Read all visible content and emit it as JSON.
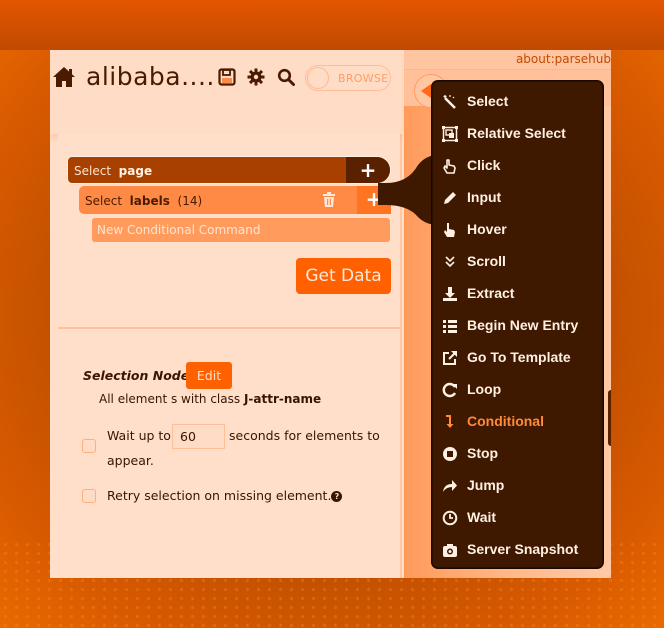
{
  "header": {
    "project_title": "alibaba....",
    "browse_toggle_label": "BROWSE"
  },
  "commands": {
    "select_page": {
      "verb": "Select",
      "target": "page"
    },
    "select_labels": {
      "verb": "Select",
      "target": "labels",
      "count": "(14)"
    },
    "conditional": "New Conditional Command",
    "get_data_label": "Get Data"
  },
  "selection_panel": {
    "node_label": "Selection Node:",
    "edit_label": "Edit",
    "description_prefix": "All element s with class",
    "description_class": "J-attr-name",
    "wait_prefix": "Wait up to",
    "wait_value": "60",
    "wait_suffix": "seconds for elements to",
    "wait_suffix2": "appear.",
    "retry_label": "Retry selection on missing element.",
    "help_glyph": "?"
  },
  "browser": {
    "url": "about:parsehub"
  },
  "menu": {
    "items": [
      {
        "label": "Select",
        "icon": "magic-wand-icon"
      },
      {
        "label": "Relative Select",
        "icon": "relative-select-icon"
      },
      {
        "label": "Click",
        "icon": "pointer-hand-icon"
      },
      {
        "label": "Input",
        "icon": "pencil-icon"
      },
      {
        "label": "Hover",
        "icon": "hover-hand-icon"
      },
      {
        "label": "Scroll",
        "icon": "double-chevron-down-icon"
      },
      {
        "label": "Extract",
        "icon": "download-icon"
      },
      {
        "label": "Begin New Entry",
        "icon": "list-icon"
      },
      {
        "label": "Go To Template",
        "icon": "external-link-icon"
      },
      {
        "label": "Loop",
        "icon": "loop-icon"
      },
      {
        "label": "Conditional",
        "icon": "conditional-arrow-icon",
        "active": true
      },
      {
        "label": "Stop",
        "icon": "stop-icon"
      },
      {
        "label": "Jump",
        "icon": "share-arrow-icon"
      },
      {
        "label": "Wait",
        "icon": "clock-icon"
      },
      {
        "label": "Server Snapshot",
        "icon": "camera-icon"
      }
    ],
    "active_color": "#ff8a3a"
  },
  "colors": {
    "accent": "#ff6000",
    "menu_bg": "#3f1800",
    "panel_bg": "#ffdfca"
  }
}
